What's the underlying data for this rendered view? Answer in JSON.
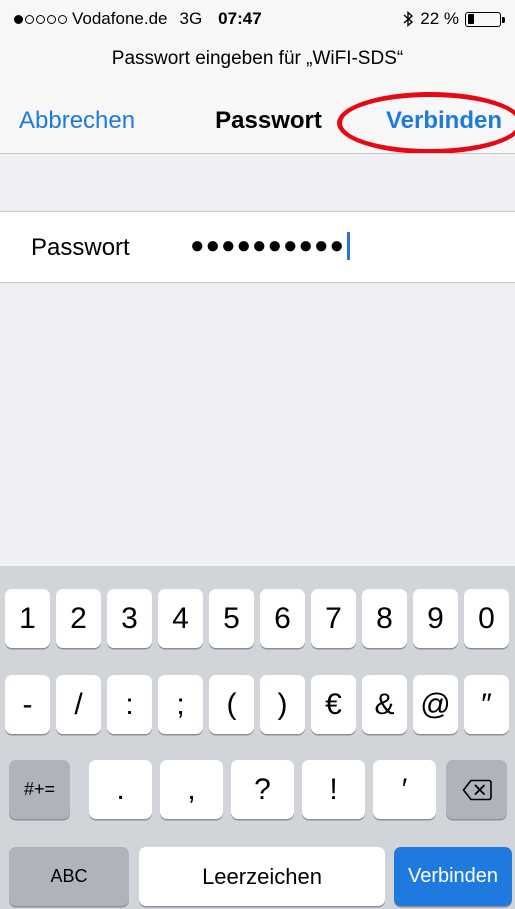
{
  "status_bar": {
    "signal_dots": [
      "filled",
      "empty",
      "empty",
      "empty",
      "empty"
    ],
    "carrier": "Vodafone.de",
    "network": "3G",
    "time": "07:47",
    "battery": "22 %",
    "battery_level": 0.22,
    "icons": [
      "bluetooth-icon",
      "battery-icon"
    ]
  },
  "prompt": {
    "text": "Passwort eingeben für „WiFI-SDS“"
  },
  "nav": {
    "cancel": "Abbrechen",
    "title": "Passwort",
    "connect": "Verbinden",
    "highlight_color": "#e50914"
  },
  "form": {
    "label": "Passwort",
    "value": "●●●●●●●●●●"
  },
  "keyboard": {
    "row1": [
      "1",
      "2",
      "3",
      "4",
      "5",
      "6",
      "7",
      "8",
      "9",
      "0"
    ],
    "row2": [
      "-",
      "/",
      ":",
      ";",
      "(",
      ")",
      "€",
      "&",
      "@",
      "″"
    ],
    "row3": [
      ".",
      ",",
      "?",
      "!",
      "′"
    ],
    "symbols_key": "#+=",
    "abc_key": "ABC",
    "space_key": "Leerzeichen",
    "return_key": "Verbinden",
    "icons": [
      "backspace-icon"
    ]
  },
  "colors": {
    "accent": "#1f7ae0",
    "keyboard_bg": "#d1d4d9",
    "dark_key": "#aeb3bc"
  }
}
